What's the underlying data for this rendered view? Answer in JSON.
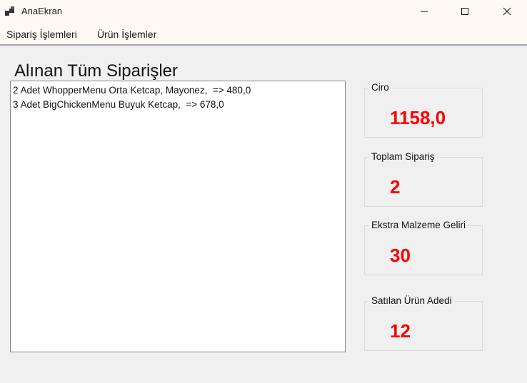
{
  "window": {
    "title": "AnaEkran"
  },
  "menu": {
    "items": [
      "Sipariş İşlemleri",
      "Ürün İşlemler"
    ]
  },
  "main": {
    "heading": "Alınan Tüm Siparişler",
    "orders": [
      "2 Adet WhopperMenu Orta Ketcap, Mayonez,  => 480,0",
      "3 Adet BigChickenMenu Buyuk Ketcap,  => 678,0"
    ]
  },
  "stats": [
    {
      "label": "Ciro",
      "value": "1158,0"
    },
    {
      "label": "Toplam Sipariş",
      "value": "2"
    },
    {
      "label": "Ekstra Malzeme Geliri",
      "value": "30"
    },
    {
      "label": "Satılan Ürün Adedi",
      "value": "12"
    }
  ],
  "colors": {
    "value_color": "#ff0000",
    "titlebar_bg": "#fcfaf2",
    "window_bg": "#f0f0f0"
  }
}
